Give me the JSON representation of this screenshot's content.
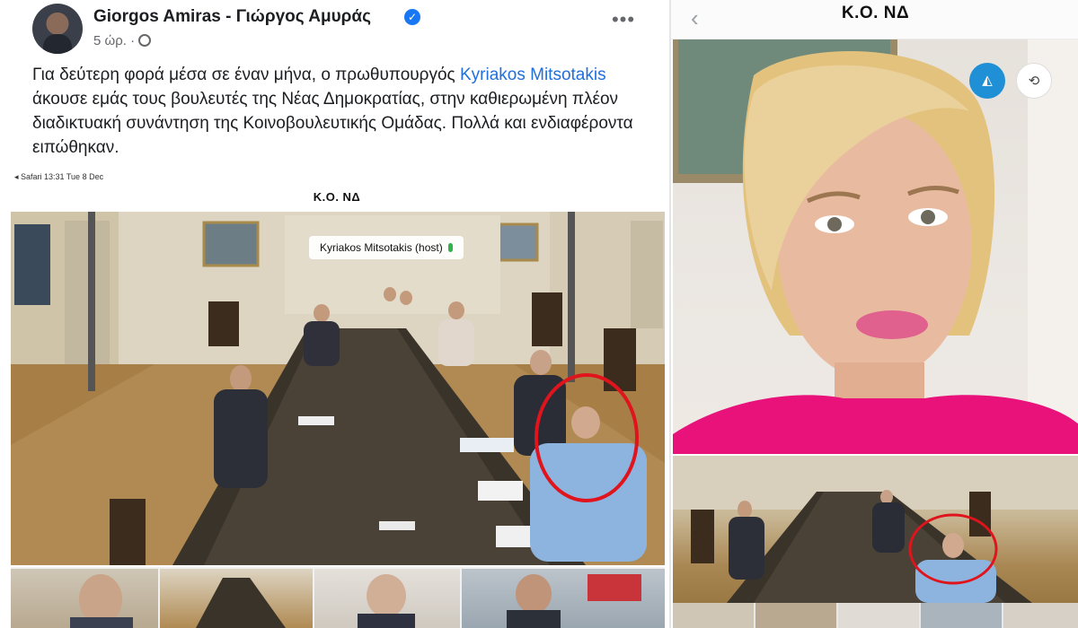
{
  "post": {
    "author": "Giorgos Amiras - Γιώργος Αμυράς",
    "time": "5 ώρ. ·",
    "text_before": "Για δεύτερη φορά μέσα σε έναν μήνα, ο πρωθυπουργός ",
    "mention": "Kyriakos Mitsotakis",
    "text_after": " άκουσε εμάς τους βουλευτές της Νέας Δημοκρατίας, στην καθιερωμένη πλέον διαδικτυακή συνάντηση της Κοινοβουλευτικής Ομάδας. Πολλά και ενδιαφέροντα ειπώθηκαν.",
    "more_label": "•••",
    "verified_icon": "verified-check-icon",
    "privacy_icon": "globe-icon"
  },
  "shared_screenshot": {
    "status_bar": "◂ Safari   13:31   Tue 8 Dec",
    "title": "Κ.Ο. ΝΔ",
    "host_label": "Kyriakos Mitsotakis (host)"
  },
  "phone": {
    "title": "Κ.Ο. ΝΔ",
    "back_icon": "chevron-left-icon",
    "mirror_icon": "mirror-icon",
    "flip_icon": "camera-flip-icon"
  },
  "colors": {
    "link": "#216fdb",
    "verified": "#1877f2",
    "highlight_circle": "#e0141c",
    "mirror_button": "#1f8fd6",
    "host_mic": "#2fb34a"
  }
}
